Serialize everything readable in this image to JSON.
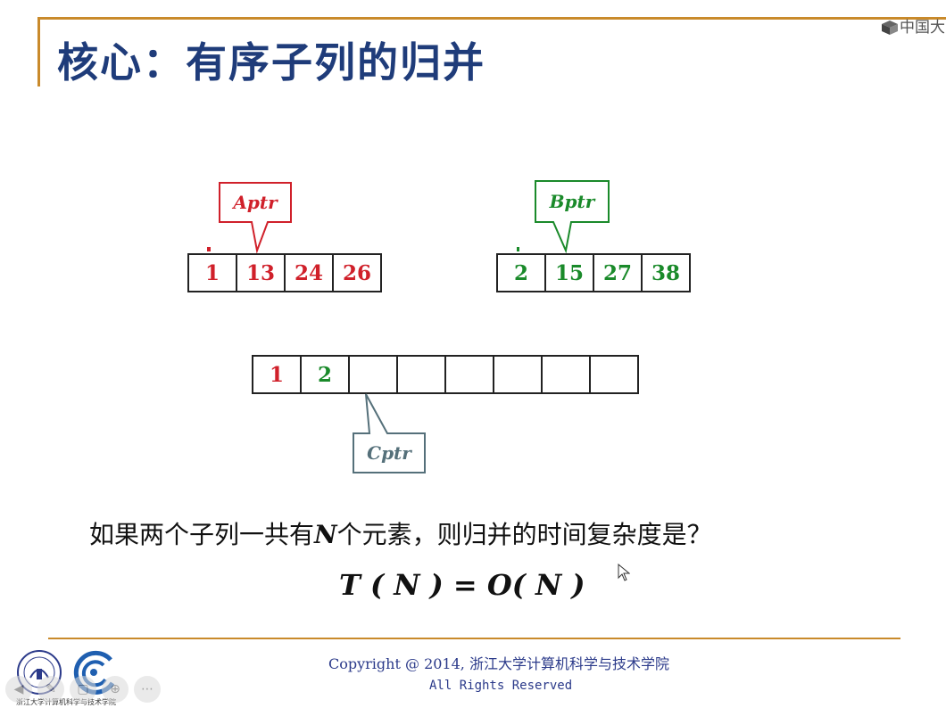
{
  "slide": {
    "title": "核心：有序子列的归并",
    "corner_brand": "中国大",
    "arrays": {
      "A": {
        "values": [
          "1",
          "13",
          "24",
          "26"
        ],
        "color": "#d0202a"
      },
      "B": {
        "values": [
          "2",
          "15",
          "27",
          "38"
        ],
        "color": "#1a8a2a"
      },
      "C": {
        "values": [
          "1",
          "2",
          "",
          "",
          "",
          "",
          "",
          ""
        ],
        "colors": [
          "#d0202a",
          "#1a8a2a"
        ]
      }
    },
    "pointers": {
      "aptr": {
        "label": "Aptr",
        "color": "#d0202a"
      },
      "bptr": {
        "label": "Bptr",
        "color": "#1a8a2a"
      },
      "cptr": {
        "label": "Cptr",
        "color": "#55707a"
      }
    },
    "question_part1": "如果两个子列一共有",
    "question_var": "N",
    "question_part2": "个元素，则归并的时间复杂度是？",
    "formula": "T ( N ) = O( N )",
    "copyright": "Copyright @ 2014, 浙江大学计算机科学与技术学院",
    "rights": "All Rights Reserved",
    "logo_text": "浙江大学计算机科学与技术学院"
  },
  "toolbar": {
    "icons": [
      "play-icon",
      "pen-icon",
      "copy-icon",
      "zoom-icon",
      "more-icon"
    ],
    "glyphs": [
      "◀",
      "✎",
      "▢",
      "⊕",
      "⋯"
    ]
  }
}
